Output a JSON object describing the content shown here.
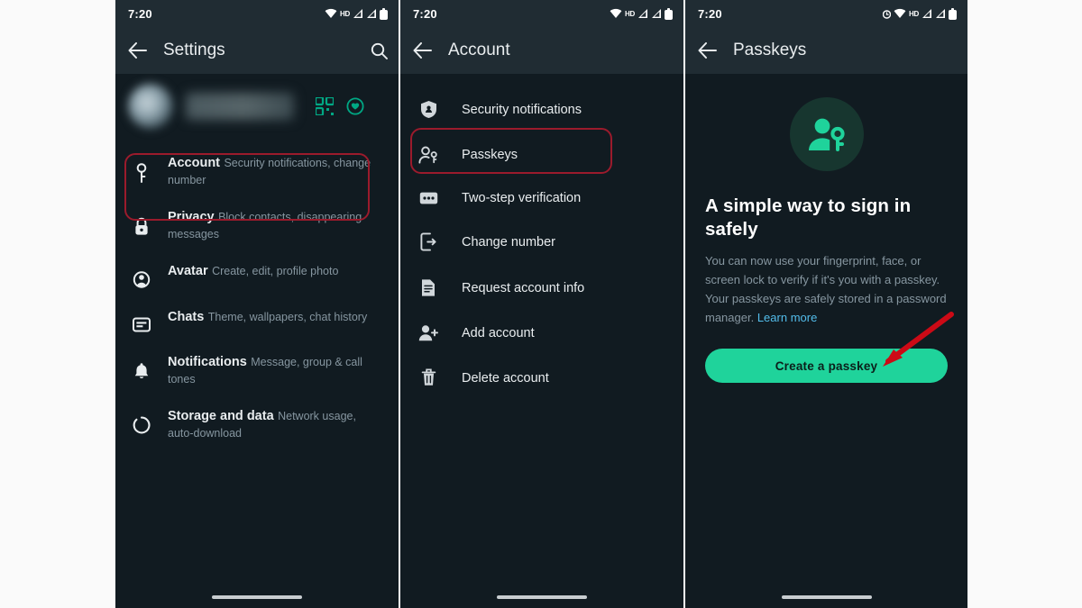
{
  "colors": {
    "app_bg": "#111b21",
    "bar_bg": "#202c33",
    "accent_green": "#1fd39b",
    "icon_green": "#00a884",
    "link_blue": "#53bdeb",
    "highlight_red": "#9b1b2c",
    "arrow_red": "#cc0a16",
    "text_primary": "#e9edef",
    "text_secondary": "#8696a0"
  },
  "panels": [
    {
      "id": "settings",
      "status": {
        "time": "7:20",
        "icons": [
          "wifi-icon",
          "hd-icon",
          "signal-icon",
          "signal-icon",
          "battery-icon"
        ]
      },
      "appbar": {
        "back": "back-arrow-icon",
        "title": "Settings",
        "action": "search-icon"
      },
      "profile": {
        "avatar": "avatar",
        "name_redacted": "",
        "actions": [
          "qr-code-icon",
          "status-ring-icon"
        ]
      },
      "items": [
        {
          "icon": "key-icon",
          "title": "Account",
          "subtitle": "Security notifications, change number",
          "highlighted": true
        },
        {
          "icon": "lock-icon",
          "title": "Privacy",
          "subtitle": "Block contacts, disappearing messages",
          "highlighted": false
        },
        {
          "icon": "avatar-icon",
          "title": "Avatar",
          "subtitle": "Create, edit, profile photo",
          "highlighted": false
        },
        {
          "icon": "chat-icon",
          "title": "Chats",
          "subtitle": "Theme, wallpapers, chat history",
          "highlighted": false
        },
        {
          "icon": "bell-icon",
          "title": "Notifications",
          "subtitle": "Message, group & call tones",
          "highlighted": false
        },
        {
          "icon": "storage-icon",
          "title": "Storage and data",
          "subtitle": "Network usage, auto-download",
          "highlighted": false
        }
      ]
    },
    {
      "id": "account",
      "status": {
        "time": "7:20",
        "icons": [
          "wifi-icon",
          "hd-icon",
          "signal-icon",
          "signal-icon",
          "battery-icon"
        ]
      },
      "appbar": {
        "back": "back-arrow-icon",
        "title": "Account",
        "action": ""
      },
      "items": [
        {
          "icon": "shield-icon",
          "label": "Security notifications",
          "highlighted": false
        },
        {
          "icon": "person-key-icon",
          "label": "Passkeys",
          "highlighted": true
        },
        {
          "icon": "two-step-icon",
          "label": "Two-step verification",
          "highlighted": false
        },
        {
          "icon": "change-number-icon",
          "label": "Change number",
          "highlighted": false
        },
        {
          "icon": "document-icon",
          "label": "Request account info",
          "highlighted": false
        },
        {
          "icon": "add-person-icon",
          "label": "Add account",
          "highlighted": false
        },
        {
          "icon": "trash-icon",
          "label": "Delete account",
          "highlighted": false
        }
      ]
    },
    {
      "id": "passkeys",
      "status": {
        "time": "7:20",
        "icons": [
          "alarm-icon",
          "wifi-icon",
          "hd-icon",
          "signal-icon",
          "signal-icon",
          "battery-icon"
        ]
      },
      "appbar": {
        "back": "back-arrow-icon",
        "title": "Passkeys",
        "action": ""
      },
      "hero_icon": "person-key-icon",
      "title": "A simple way to sign in safely",
      "body": "You can now use your fingerprint, face, or screen lock to verify if it's you with a passkey. Your passkeys are safely stored in a password manager. ",
      "link": "Learn more",
      "cta": "Create a passkey"
    }
  ]
}
